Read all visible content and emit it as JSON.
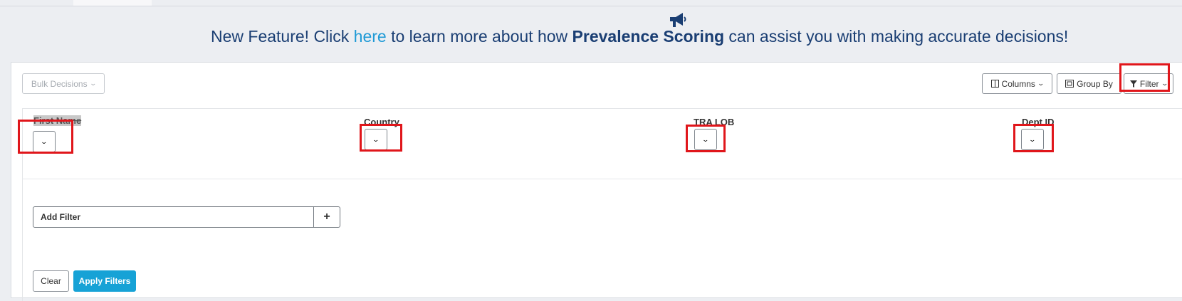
{
  "announcement": {
    "prefix": "New Feature! Click ",
    "link": "here",
    "middle": " to learn more about how ",
    "bold": "Prevalence Scoring",
    "suffix": " can assist you with making accurate decisions!"
  },
  "toolbar": {
    "bulk_decisions": "Bulk Decisions",
    "columns": "Columns",
    "group_by": "Group By",
    "filter": "Filter"
  },
  "filter_columns": [
    {
      "label": "First Name"
    },
    {
      "label": "Country"
    },
    {
      "label": "TRA LOB"
    },
    {
      "label": "Dept ID"
    }
  ],
  "add_filter": {
    "label": "Add Filter",
    "plus": "+"
  },
  "actions": {
    "clear": "Clear",
    "apply": "Apply Filters"
  },
  "colors": {
    "accent": "#16a2d6",
    "headline": "#1a3e73",
    "highlight_box": "#e0161b"
  }
}
